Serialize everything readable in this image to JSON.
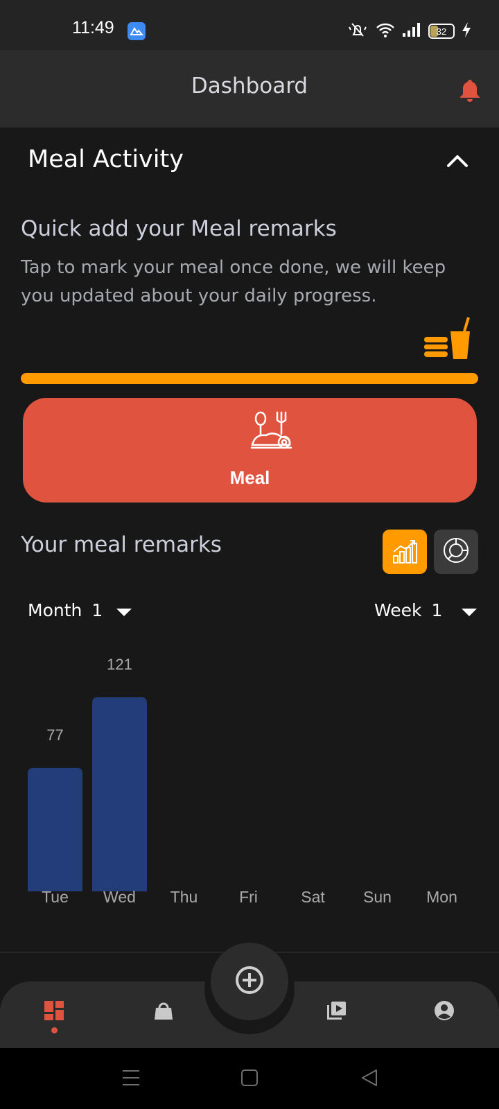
{
  "status_bar": {
    "time": "11:49",
    "battery_level": "32",
    "icons": [
      "mute-icon",
      "wifi-icon",
      "signal-icon",
      "battery-icon",
      "charging-icon"
    ]
  },
  "header": {
    "title": "Dashboard",
    "notification_icon": "bell-icon",
    "accent_color": "#e0533f"
  },
  "meal_activity": {
    "title": "Meal Activity",
    "collapse_icon": "chevron-up-icon",
    "quick_add_title": "Quick add your Meal remarks",
    "quick_add_subtitle": "Tap to mark your meal once done, we will keep you updated about your daily progress.",
    "progress_icon": "burger-drink-icon",
    "progress_fraction": 1.0,
    "progress_color": "#ff9a00",
    "meal_button_label": "Meal",
    "meal_button_icon": "meal-plate-icon",
    "meal_button_color": "#e0533f"
  },
  "remarks": {
    "title": "Your meal remarks",
    "bar_toggle_icon": "bar-chart-icon",
    "pie_toggle_icon": "pie-chart-icon",
    "month_label": "Month",
    "month_value": "1",
    "week_label": "Week",
    "week_value": "1"
  },
  "chart_data": {
    "type": "bar",
    "categories": [
      "Tue",
      "Wed",
      "Thu",
      "Fri",
      "Sat",
      "Sun",
      "Mon"
    ],
    "values": [
      77,
      121,
      null,
      null,
      null,
      null,
      null
    ],
    "value_labels": [
      "77",
      "121",
      "",
      "",
      "",
      "",
      ""
    ],
    "ylim": [
      0,
      121
    ],
    "bar_color": "#233d7a",
    "grid": false
  },
  "bottom_nav": {
    "items": [
      {
        "icon": "dashboard-icon",
        "active": true
      },
      {
        "icon": "shopping-bag-icon",
        "active": false
      },
      {
        "icon": "video-library-icon",
        "active": false
      },
      {
        "icon": "account-icon",
        "active": false
      }
    ],
    "fab_icon": "add-circle-icon"
  },
  "system_nav": {
    "icons": [
      "menu-icon",
      "home-icon",
      "back-icon"
    ]
  }
}
